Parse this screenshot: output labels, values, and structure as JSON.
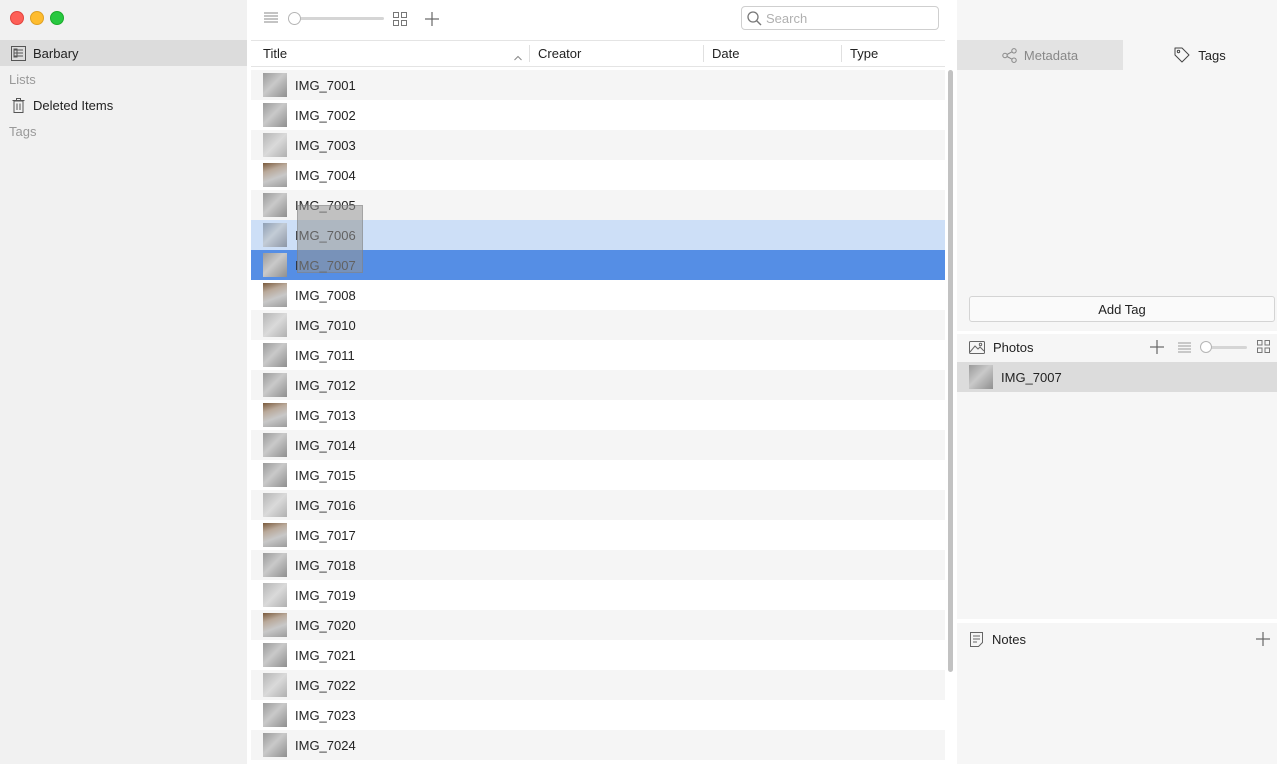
{
  "sidebar": {
    "library_label": "Barbary",
    "lists_header": "Lists",
    "deleted_label": "Deleted Items",
    "tags_header": "Tags"
  },
  "toolbar": {
    "search_placeholder": "Search"
  },
  "table": {
    "columns": [
      "Title",
      "Creator",
      "Date",
      "Type"
    ],
    "sort_column": "Title",
    "sort_direction": "ascending",
    "rows": [
      {
        "title": "IMG_7001",
        "state": "normal"
      },
      {
        "title": "IMG_7002",
        "state": "normal"
      },
      {
        "title": "IMG_7003",
        "state": "normal"
      },
      {
        "title": "IMG_7004",
        "state": "normal"
      },
      {
        "title": "IMG_7005",
        "state": "normal"
      },
      {
        "title": "IMG_7006",
        "state": "drop-target"
      },
      {
        "title": "IMG_7007",
        "state": "selected"
      },
      {
        "title": "IMG_7008",
        "state": "normal"
      },
      {
        "title": "IMG_7010",
        "state": "normal"
      },
      {
        "title": "IMG_7011",
        "state": "normal"
      },
      {
        "title": "IMG_7012",
        "state": "normal"
      },
      {
        "title": "IMG_7013",
        "state": "normal"
      },
      {
        "title": "IMG_7014",
        "state": "normal"
      },
      {
        "title": "IMG_7015",
        "state": "normal"
      },
      {
        "title": "IMG_7016",
        "state": "normal"
      },
      {
        "title": "IMG_7017",
        "state": "normal"
      },
      {
        "title": "IMG_7018",
        "state": "normal"
      },
      {
        "title": "IMG_7019",
        "state": "normal"
      },
      {
        "title": "IMG_7020",
        "state": "normal"
      },
      {
        "title": "IMG_7021",
        "state": "normal"
      },
      {
        "title": "IMG_7022",
        "state": "normal"
      },
      {
        "title": "IMG_7023",
        "state": "normal"
      },
      {
        "title": "IMG_7024",
        "state": "normal"
      }
    ]
  },
  "inspector": {
    "tabs": [
      "Metadata",
      "Tags"
    ],
    "active_tab": "Tags",
    "add_tag_label": "Add Tag",
    "photos_label": "Photos",
    "photos": [
      "IMG_7007"
    ],
    "notes_label": "Notes"
  },
  "colors": {
    "selection": "#558ee5",
    "drop_target": "#cddff7",
    "sidebar_bg": "#f1f1f1"
  }
}
